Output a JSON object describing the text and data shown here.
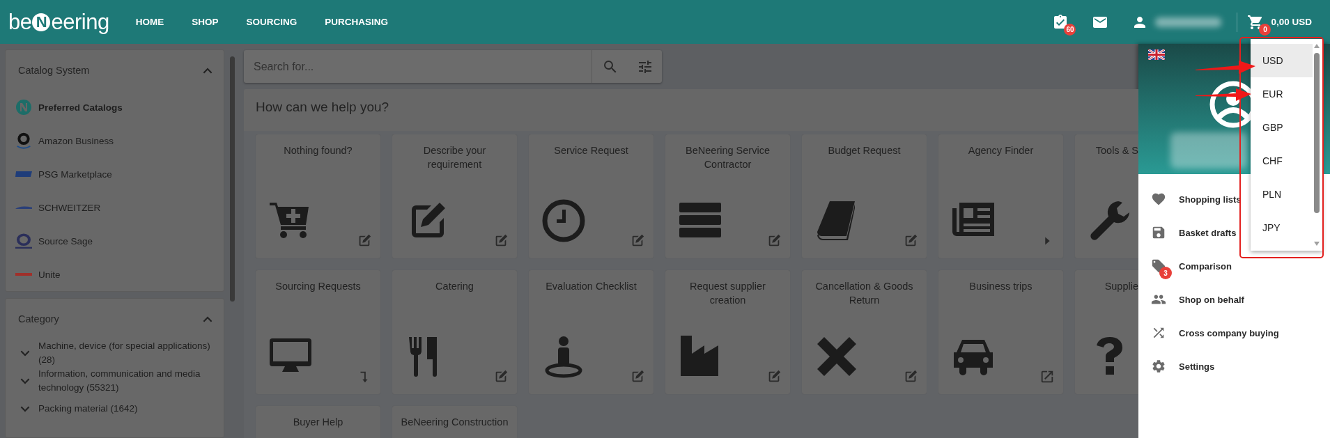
{
  "header": {
    "logo": {
      "before": "be",
      "mark": "N",
      "after": "eering"
    },
    "nav": [
      {
        "label": "HOME"
      },
      {
        "label": "SHOP"
      },
      {
        "label": "SOURCING"
      },
      {
        "label": "PURCHASING"
      }
    ],
    "tasks_badge": "60",
    "cart_badge": "0",
    "cart_total": "0,00 USD"
  },
  "sidebar": {
    "catalog": {
      "title": "Catalog System",
      "expanded": true,
      "items": [
        {
          "label": "Preferred Catalogs",
          "selected": true
        },
        {
          "label": "Amazon Business",
          "selected": false
        },
        {
          "label": "PSG Marketplace",
          "selected": false
        },
        {
          "label": "SCHWEITZER",
          "selected": false
        },
        {
          "label": "Source Sage",
          "selected": false
        },
        {
          "label": "Unite",
          "selected": false
        }
      ]
    },
    "category": {
      "title": "Category",
      "expanded": true,
      "items": [
        {
          "label": "Machine, device (for special applications) (28)",
          "expanded": false
        },
        {
          "label": "Information, communication and media technology (55321)",
          "expanded": false
        },
        {
          "label": "Packing material (1642)",
          "expanded": false
        }
      ]
    }
  },
  "search": {
    "placeholder": "Search for..."
  },
  "help": {
    "title": "How can we help you?",
    "tiles": [
      {
        "title": "Nothing found?"
      },
      {
        "title": "Describe your requirement"
      },
      {
        "title": "Service Request"
      },
      {
        "title": "BeNeering Service Contractor"
      },
      {
        "title": "Budget Request"
      },
      {
        "title": "Agency Finder"
      },
      {
        "title": "Tools & S"
      },
      {
        "title": "Sourcing Requests"
      },
      {
        "title": "Catering"
      },
      {
        "title": "Evaluation Checklist"
      },
      {
        "title": "Request supplier creation"
      },
      {
        "title": "Cancellation & Goods Return"
      },
      {
        "title": "Business trips"
      },
      {
        "title": "Supplie"
      },
      {
        "title": "Buyer Help"
      },
      {
        "title": "BeNeering Construction"
      }
    ]
  },
  "user_panel": {
    "menu": [
      {
        "label": "Shopping lists"
      },
      {
        "label": "Basket drafts"
      },
      {
        "label": "Comparison",
        "badge": "3"
      },
      {
        "label": "Shop on behalf"
      },
      {
        "label": "Cross company buying"
      },
      {
        "label": "Settings"
      }
    ]
  },
  "currency_dropdown": {
    "options": [
      {
        "label": "USD",
        "selected": true
      },
      {
        "label": "EUR",
        "selected": false
      },
      {
        "label": "GBP",
        "selected": false
      },
      {
        "label": "CHF",
        "selected": false
      },
      {
        "label": "PLN",
        "selected": false
      },
      {
        "label": "JPY",
        "selected": false
      }
    ]
  }
}
